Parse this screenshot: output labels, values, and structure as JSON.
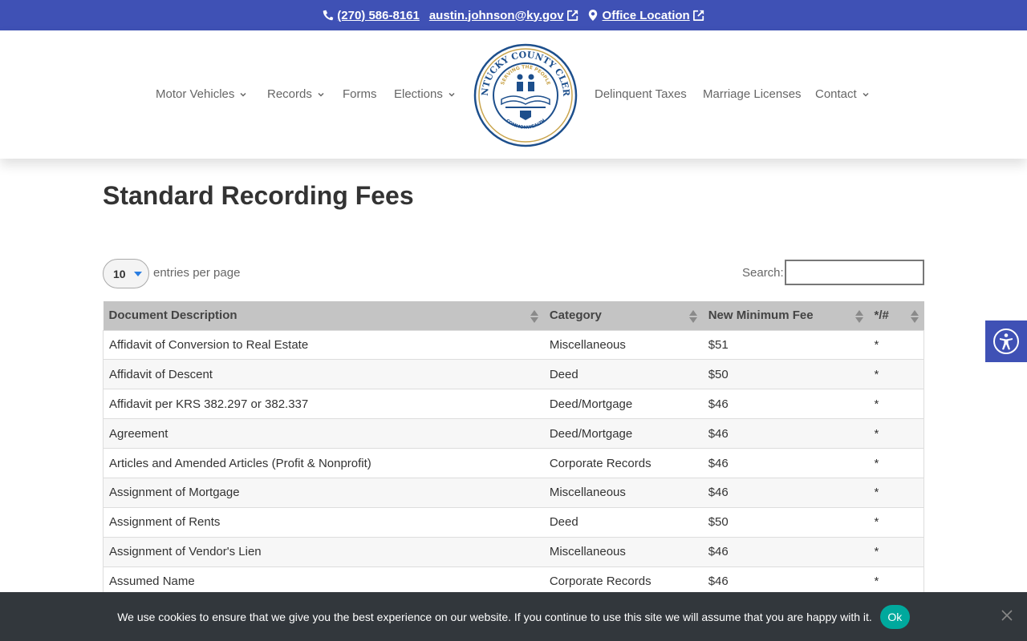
{
  "topbar": {
    "phone": "(270) 586-8161",
    "email": "austin.johnson@ky.gov",
    "office": "Office Location"
  },
  "nav": {
    "motor_vehicles": "Motor Vehicles",
    "records": "Records",
    "forms": "Forms",
    "elections": "Elections",
    "delinquent_taxes": "Delinquent Taxes",
    "marriage_licenses": "Marriage Licenses",
    "contact": "Contact"
  },
  "logo": {
    "text_top": "KENTUCKY COUNTY CLERKS",
    "text_inner": "SERVING THE PEOPLE",
    "text_bottom": "COMMONWEALTH"
  },
  "page": {
    "title": "Standard Recording Fees"
  },
  "table_controls": {
    "page_length": "10",
    "page_length_label": "entries per page",
    "search_label": "Search:",
    "search_value": ""
  },
  "table": {
    "headers": [
      "Document Description",
      "Category",
      "New Minimum Fee",
      "*/#"
    ],
    "rows": [
      [
        "Affidavit of Conversion to Real Estate",
        "Miscellaneous",
        "$51",
        "*"
      ],
      [
        "Affidavit of Descent",
        "Deed",
        "$50",
        "*"
      ],
      [
        "Affidavit per KRS 382.297 or 382.337",
        "Deed/Mortgage",
        "$46",
        "*"
      ],
      [
        "Agreement",
        "Deed/Mortgage",
        "$46",
        "*"
      ],
      [
        "Articles and Amended Articles (Profit & Nonprofit)",
        "Corporate Records",
        "$46",
        "*"
      ],
      [
        "Assignment of Mortgage",
        "Miscellaneous",
        "$46",
        "*"
      ],
      [
        "Assignment of Rents",
        "Deed",
        "$50",
        "*"
      ],
      [
        "Assignment of Vendor's Lien",
        "Miscellaneous",
        "$46",
        "*"
      ],
      [
        "Assumed Name",
        "Corporate Records",
        "$46",
        "*"
      ]
    ]
  },
  "cookie": {
    "message": "We use cookies to ensure that we give you the best experience on our website. If you continue to use this site we will assume that you are happy with it.",
    "ok_label": "Ok"
  },
  "colors": {
    "brand_blue": "#3f51b5",
    "cookie_bg": "#32373c",
    "ok_teal": "#00a99d",
    "table_header": "#c4c4c4"
  }
}
